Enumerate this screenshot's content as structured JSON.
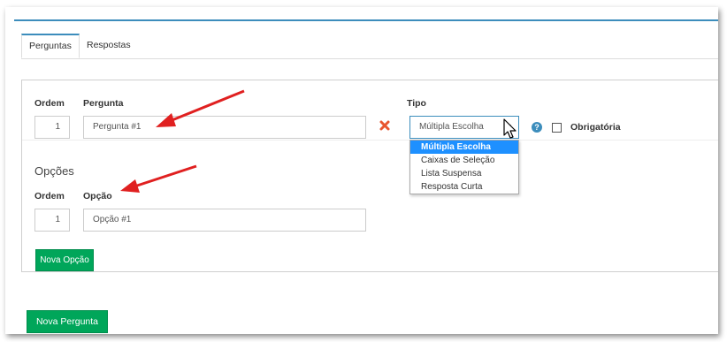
{
  "tabs": [
    {
      "label": "Perguntas",
      "active": true
    },
    {
      "label": "Respostas",
      "active": false
    }
  ],
  "question": {
    "ordem_label": "Ordem",
    "pergunta_label": "Pergunta",
    "tipo_label": "Tipo",
    "ordem_value": "1",
    "pergunta_value": "Pergunta #1",
    "tipo_value": "Múltipla Escolha",
    "help_icon": "?",
    "obrigatoria_label": "Obrigatória"
  },
  "tipo_options": [
    "Múltipla Escolha",
    "Caixas de Seleção",
    "Lista Suspensa",
    "Resposta Curta"
  ],
  "options_section": {
    "title": "Opções",
    "ordem_label": "Ordem",
    "opcao_label": "Opção",
    "ordem_value": "1",
    "opcao_value": "Opção #1"
  },
  "buttons": {
    "nova_opcao": "Nova Opção",
    "nova_pergunta": "Nova Pergunta"
  },
  "colors": {
    "accent": "#3c8dbc",
    "green": "#00a65a",
    "danger": "#e8562f",
    "arrow": "#e02020"
  }
}
